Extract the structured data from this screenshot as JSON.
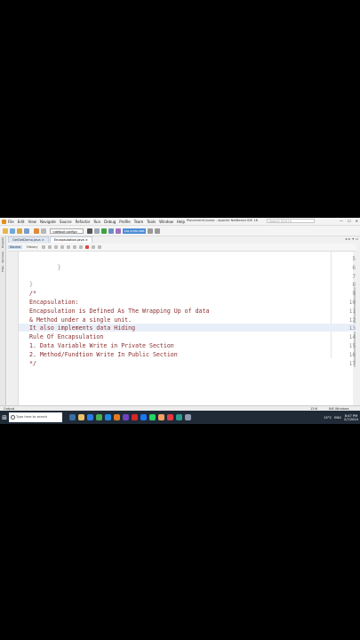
{
  "window": {
    "title": "PlacementCourse - Apache NetBeans IDE 18",
    "search_placeholder": "Search (Ctrl+I)",
    "minimize": "—",
    "maximize": "☐",
    "close": "✕"
  },
  "menu": [
    "File",
    "Edit",
    "View",
    "Navigate",
    "Source",
    "Refactor",
    "Run",
    "Debug",
    "Profile",
    "Team",
    "Tools",
    "Window",
    "Help"
  ],
  "toolbar": {
    "config": "<default config>",
    "memory": "196.4/386.0MB"
  },
  "side_panels": [
    "Projects",
    "Services",
    "Files"
  ],
  "tabs": [
    {
      "label": "GetSetDemo.java",
      "close": "×"
    },
    {
      "label": "Encapsulation.java",
      "close": "×"
    }
  ],
  "editor_modes": [
    "Source",
    "History"
  ],
  "lines": [
    {
      "n": "5",
      "text": "",
      "style": ""
    },
    {
      "n": "6",
      "text": "        }",
      "style": "plain"
    },
    {
      "n": "7",
      "text": "",
      "style": ""
    },
    {
      "n": "8",
      "text": "}",
      "style": "plain"
    },
    {
      "n": "9",
      "text": "/*",
      "style": "cm"
    },
    {
      "n": "10",
      "text": "Encapsulation:",
      "style": "cm"
    },
    {
      "n": "11",
      "text": "Encapsulation is Defined As The Wrapping Up of data",
      "style": "cm"
    },
    {
      "n": "12",
      "text": "& Method under a single unit.",
      "style": "cm"
    },
    {
      "n": "13",
      "text": "It also implements data Hiding",
      "style": "cm"
    },
    {
      "n": "14",
      "text": "Rule Of Encapsulation",
      "style": "cm"
    },
    {
      "n": "15",
      "text": "1. Data Variable Write in Private Section",
      "style": "cm"
    },
    {
      "n": "16",
      "text": "2. Method/Fundtion Write In Public Section",
      "style": "cm"
    },
    {
      "n": "17",
      "text": "*/",
      "style": "cm"
    }
  ],
  "status": {
    "output": "Output",
    "position": "13:6",
    "mode": "INS  Windows (CRLF)"
  },
  "taskbar": {
    "search": "Type here to search",
    "temp": "15°C",
    "time": "8:47 PM",
    "date": "2/7/2024",
    "lang": "ENG"
  },
  "colors": {
    "comment": "#8a2f2f",
    "accent": "#4d8ed6",
    "taskbar": "#1f2a36"
  }
}
